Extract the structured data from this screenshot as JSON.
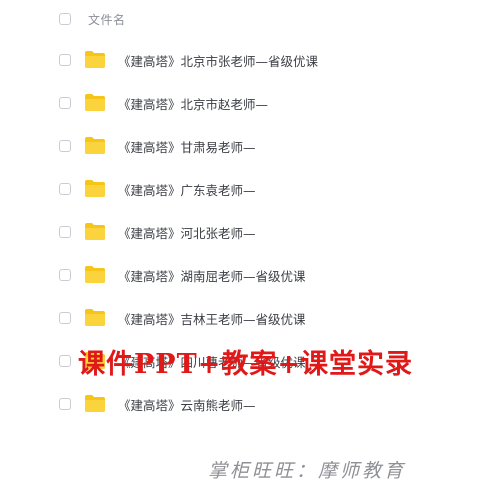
{
  "header": {
    "column_label": "文件名"
  },
  "files": [
    {
      "name": "《建高塔》北京市张老师—省级优课",
      "icon": "folder-icon"
    },
    {
      "name": "《建高塔》北京市赵老师—",
      "icon": "folder-icon"
    },
    {
      "name": "《建高塔》甘肃易老师—",
      "icon": "folder-icon"
    },
    {
      "name": "《建高塔》广东袁老师—",
      "icon": "folder-icon"
    },
    {
      "name": "《建高塔》河北张老师—",
      "icon": "folder-icon"
    },
    {
      "name": "《建高塔》湖南屈老师—省级优课",
      "icon": "folder-icon"
    },
    {
      "name": "《建高塔》吉林王老师—省级优课",
      "icon": "folder-icon"
    },
    {
      "name": "《建高塔》四川曹老师—省级优课",
      "icon": "folder-icon"
    },
    {
      "name": "《建高塔》云南熊老师—",
      "icon": "folder-icon"
    }
  ],
  "overlay": {
    "caption": "课件PPT+教案+课堂实录",
    "watermark": "掌柜旺旺：摩师教育"
  },
  "colors": {
    "folder": "#f5c518",
    "overlay_text": "#e01818"
  }
}
